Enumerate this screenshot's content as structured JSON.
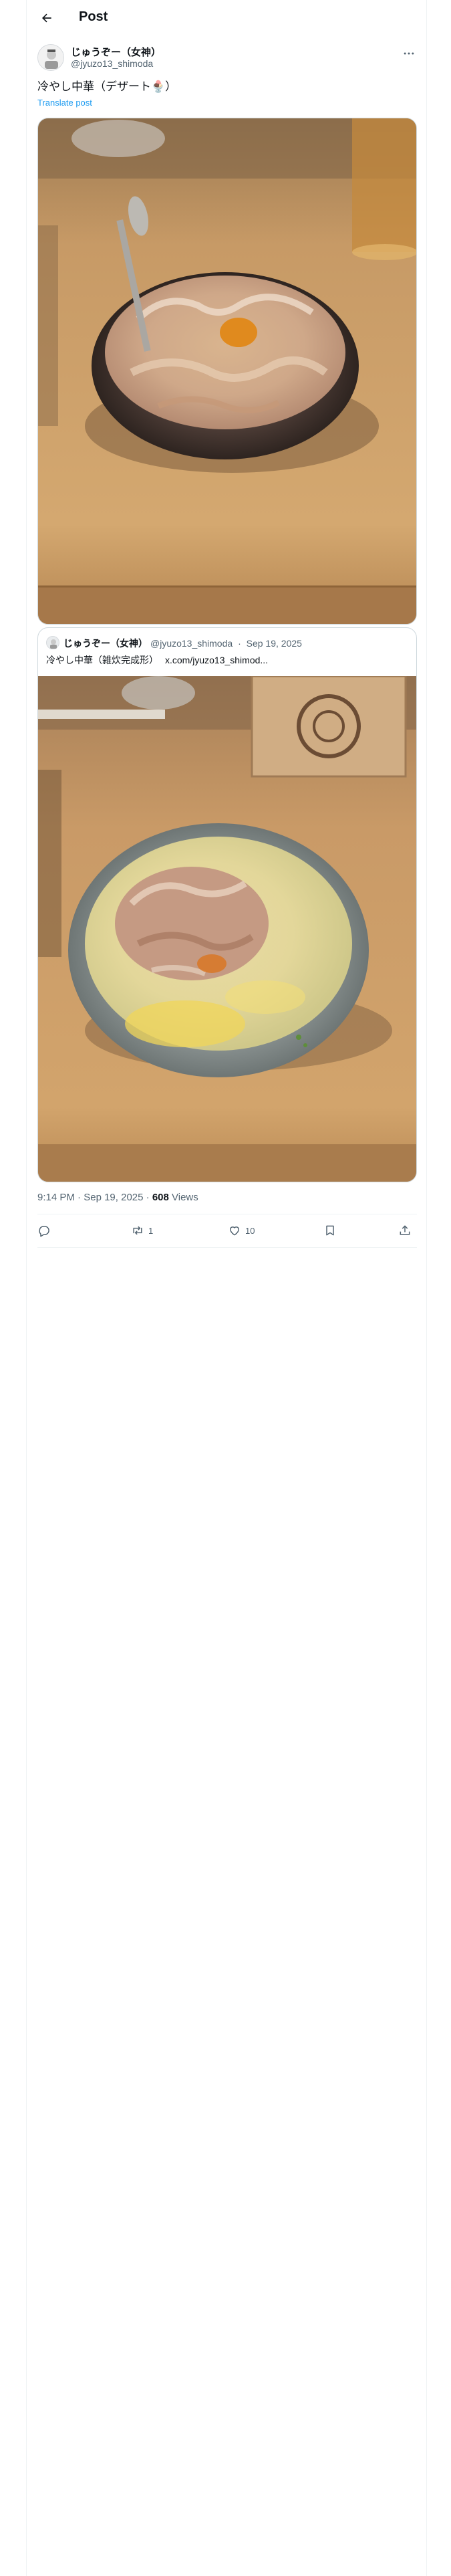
{
  "header": {
    "title": "Post"
  },
  "post": {
    "author_name": "じゅうぞー（女神）",
    "author_handle": "@jyuzo13_shimoda",
    "text": "冷やし中華（デザート🍨）",
    "translate_label": "Translate post"
  },
  "quote": {
    "author_name": "じゅうぞー（女神）",
    "author_handle": "@jyuzo13_shimoda",
    "date": "Sep 19, 2025",
    "separator": "·",
    "text": "冷やし中華（雑炊完成形）",
    "link": "x.com/jyuzo13_shimod..."
  },
  "meta": {
    "time": "9:14 PM",
    "date": "Sep 19, 2025",
    "separator": "·",
    "views_count": "608",
    "views_label": "Views"
  },
  "actions": {
    "reply_count": "",
    "repost_count": "1",
    "like_count": "10"
  },
  "icons": {
    "back": "arrow-left-icon",
    "more": "more-horizontal-icon",
    "reply": "reply-icon",
    "repost": "repost-icon",
    "like": "heart-icon",
    "bookmark": "bookmark-icon",
    "share": "share-icon"
  },
  "colors": {
    "accent": "#1d9bf0",
    "secondary_text": "#536471",
    "border": "#cfd9de"
  }
}
